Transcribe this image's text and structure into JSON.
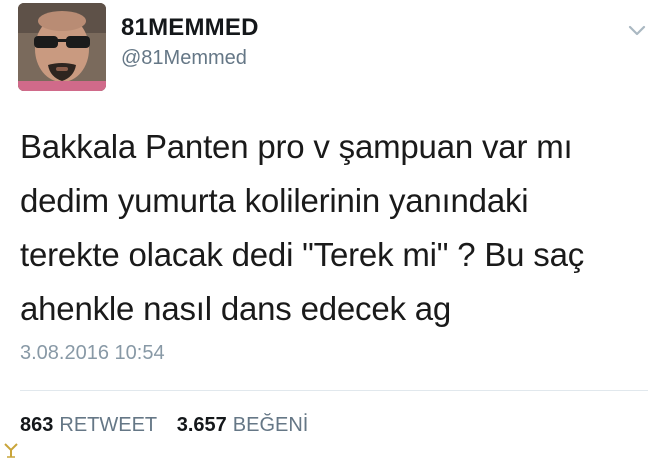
{
  "user": {
    "display_name": "81MEMMED",
    "handle": "@81Memmed",
    "avatar_icon": "profile-photo"
  },
  "menu": {
    "icon": "chevron-down-icon"
  },
  "tweet": {
    "lines": [
      "Bakkala Panten pro v şampuan var mı",
      "dedim yumurta kolilerinin yanındaki",
      "terekte olacak dedi \"Terek mi\" ? Bu saç",
      "ahenkle nasıl dans edecek ag"
    ],
    "timestamp": "3.08.2016 10:54"
  },
  "stats": {
    "retweets_count": "863",
    "retweets_label": "RETWEET",
    "likes_count": "3.657",
    "likes_label": "BEĞENİ"
  },
  "colors": {
    "text": "#14171a",
    "secondary": "#657786",
    "timestamp": "#8899a6",
    "divider": "#e1e8ed"
  }
}
